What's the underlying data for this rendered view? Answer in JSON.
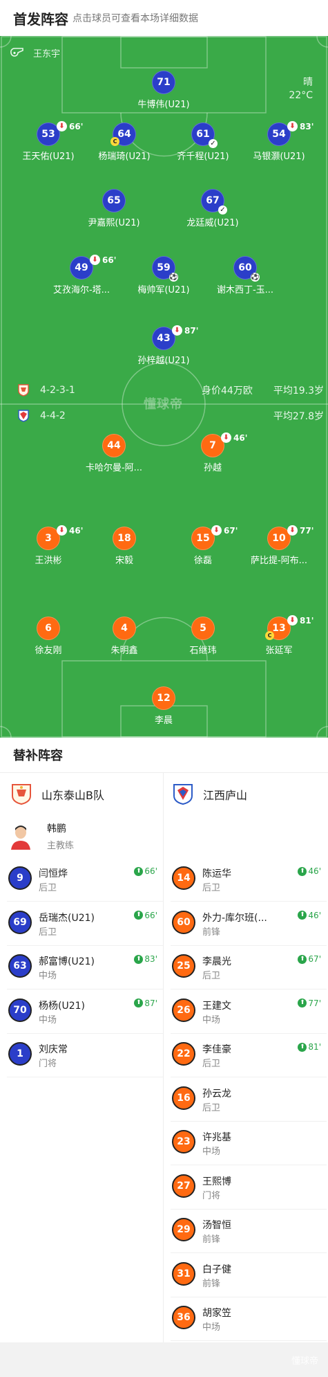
{
  "header": {
    "title": "首发阵容",
    "subtitle": "点击球员可查看本场详细数据"
  },
  "referee": {
    "name": "王东宇",
    "icon": "whistle-icon"
  },
  "weather": {
    "condition": "晴",
    "temperature": "22°C"
  },
  "watermark": "懂球帝",
  "home_team": {
    "formation": "4-2-3-1",
    "value": "身价44万欧",
    "avg_age": "平均19.3岁",
    "crest_color": "#e6553b"
  },
  "away_team": {
    "formation": "4-4-2",
    "avg_age": "平均27.8岁",
    "crest_color": "#2c5bc7"
  },
  "colors": {
    "home": "#2b3ec9",
    "away": "#ff6a12",
    "pitch": "#3aaa48",
    "sub_in": "#2aa54a",
    "sub_out": "#e23a3a",
    "captain": "#ffd83a"
  },
  "home_players": [
    {
      "num": "71",
      "name": "牛博伟(U21)"
    },
    {
      "num": "53",
      "name": "王天佑(U21)",
      "sub_out": "66'"
    },
    {
      "num": "64",
      "name": "杨瑞琦(U21)"
    },
    {
      "num": "61",
      "name": "齐千程(U21)"
    },
    {
      "num": "54",
      "name": "马银灏(U21)",
      "sub_out": "83'"
    },
    {
      "num": "65",
      "name": "尹嘉熙(U21)"
    },
    {
      "num": "67",
      "name": "龙廷威(U21)"
    },
    {
      "num": "49",
      "name": "艾孜海尔-塔...",
      "sub_out": "66'"
    },
    {
      "num": "59",
      "name": "梅帅军(U21)"
    },
    {
      "num": "60",
      "name": "谢木西丁-玉..."
    },
    {
      "num": "43",
      "name": "孙梓越(U21)",
      "sub_out": "87'"
    }
  ],
  "away_players": [
    {
      "num": "44",
      "name": "卡哈尔曼-阿..."
    },
    {
      "num": "7",
      "name": "孙越",
      "sub_out": "46'"
    },
    {
      "num": "3",
      "name": "王洪彬",
      "sub_out": "46'"
    },
    {
      "num": "18",
      "name": "宋毅"
    },
    {
      "num": "15",
      "name": "徐磊",
      "sub_out": "67'"
    },
    {
      "num": "10",
      "name": "萨比提-阿布...",
      "sub_out": "77'"
    },
    {
      "num": "6",
      "name": "徐友刚"
    },
    {
      "num": "4",
      "name": "朱明鑫"
    },
    {
      "num": "5",
      "name": "石继玮"
    },
    {
      "num": "13",
      "name": "张延军",
      "sub_out": "81'"
    },
    {
      "num": "12",
      "name": "李晨"
    }
  ],
  "subs": {
    "title": "替补阵容",
    "home": {
      "team_name": "山东泰山B队",
      "coach": {
        "name": "韩鹏",
        "role": "主教练"
      },
      "players": [
        {
          "num": "9",
          "name": "闫恒烨",
          "pos": "后卫",
          "in": "66'"
        },
        {
          "num": "69",
          "name": "岳瑞杰(U21)",
          "pos": "后卫",
          "in": "66'"
        },
        {
          "num": "63",
          "name": "郝富博(U21)",
          "pos": "中场",
          "in": "83'"
        },
        {
          "num": "70",
          "name": "杨杨(U21)",
          "pos": "中场",
          "in": "87'"
        },
        {
          "num": "1",
          "name": "刘庆常",
          "pos": "门将"
        }
      ]
    },
    "away": {
      "team_name": "江西庐山",
      "players": [
        {
          "num": "14",
          "name": "陈运华",
          "pos": "后卫",
          "in": "46'"
        },
        {
          "num": "60",
          "name": "外力-库尔班(...",
          "pos": "前锋",
          "in": "46'"
        },
        {
          "num": "25",
          "name": "李晨光",
          "pos": "后卫",
          "in": "67'"
        },
        {
          "num": "26",
          "name": "王建文",
          "pos": "中场",
          "in": "77'"
        },
        {
          "num": "22",
          "name": "李佳豪",
          "pos": "后卫",
          "in": "81'"
        },
        {
          "num": "16",
          "name": "孙云龙",
          "pos": "后卫"
        },
        {
          "num": "23",
          "name": "许兆基",
          "pos": "中场"
        },
        {
          "num": "27",
          "name": "王熙博",
          "pos": "门将"
        },
        {
          "num": "29",
          "name": "汤智恒",
          "pos": "前锋"
        },
        {
          "num": "31",
          "name": "白子健",
          "pos": "前锋"
        },
        {
          "num": "36",
          "name": "胡家笠",
          "pos": "中场"
        }
      ]
    }
  }
}
